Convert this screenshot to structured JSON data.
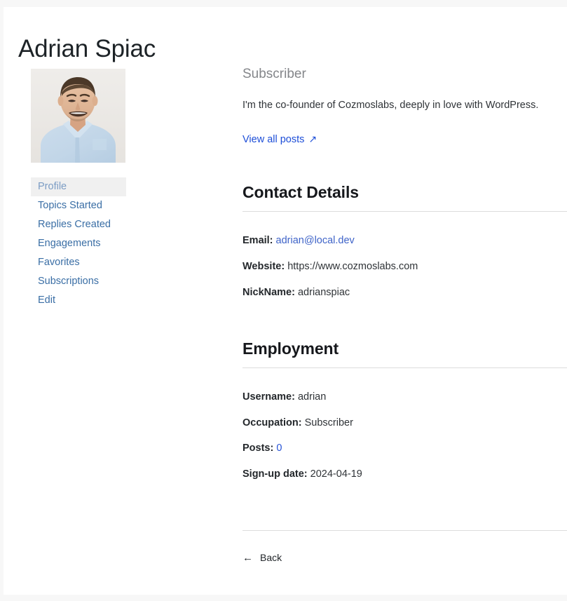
{
  "profile": {
    "name": "Adrian Spiac",
    "role": "Subscriber",
    "bio": "I'm the co-founder of Cozmoslabs, deeply in love with WordPress.",
    "view_all_posts_label": "View all posts",
    "external_link_icon": "↗",
    "avatar_alt": "avatar-photo"
  },
  "nav": {
    "items": [
      {
        "label": "Profile",
        "active": true
      },
      {
        "label": "Topics Started",
        "active": false
      },
      {
        "label": "Replies Created",
        "active": false
      },
      {
        "label": "Engagements",
        "active": false
      },
      {
        "label": "Favorites",
        "active": false
      },
      {
        "label": "Subscriptions",
        "active": false
      },
      {
        "label": "Edit",
        "active": false
      }
    ]
  },
  "contact_details": {
    "heading": "Contact Details",
    "email_label": "Email:",
    "email_value": "adrian@local.dev",
    "website_label": "Website:",
    "website_value": "https://www.cozmoslabs.com",
    "nickname_label": "NickName:",
    "nickname_value": "adrianspiac"
  },
  "employment": {
    "heading": "Employment",
    "username_label": "Username:",
    "username_value": "adrian",
    "occupation_label": "Occupation:",
    "occupation_value": "Subscriber",
    "posts_label": "Posts:",
    "posts_value": "0",
    "signup_label": "Sign-up date:",
    "signup_value": "2024-04-19"
  },
  "footer": {
    "back_label": "Back",
    "back_arrow_icon": "←"
  },
  "colors": {
    "link_blue": "#1d4ed8",
    "value_link_blue": "#3e63c8",
    "nav_blue": "#3a6ea5",
    "nav_active_blue": "#7b9cc4",
    "nav_active_bg": "#f0f0f0",
    "rule_grey": "#dcdcdc",
    "page_grey": "#f7f7f7",
    "role_grey": "#84868a"
  }
}
